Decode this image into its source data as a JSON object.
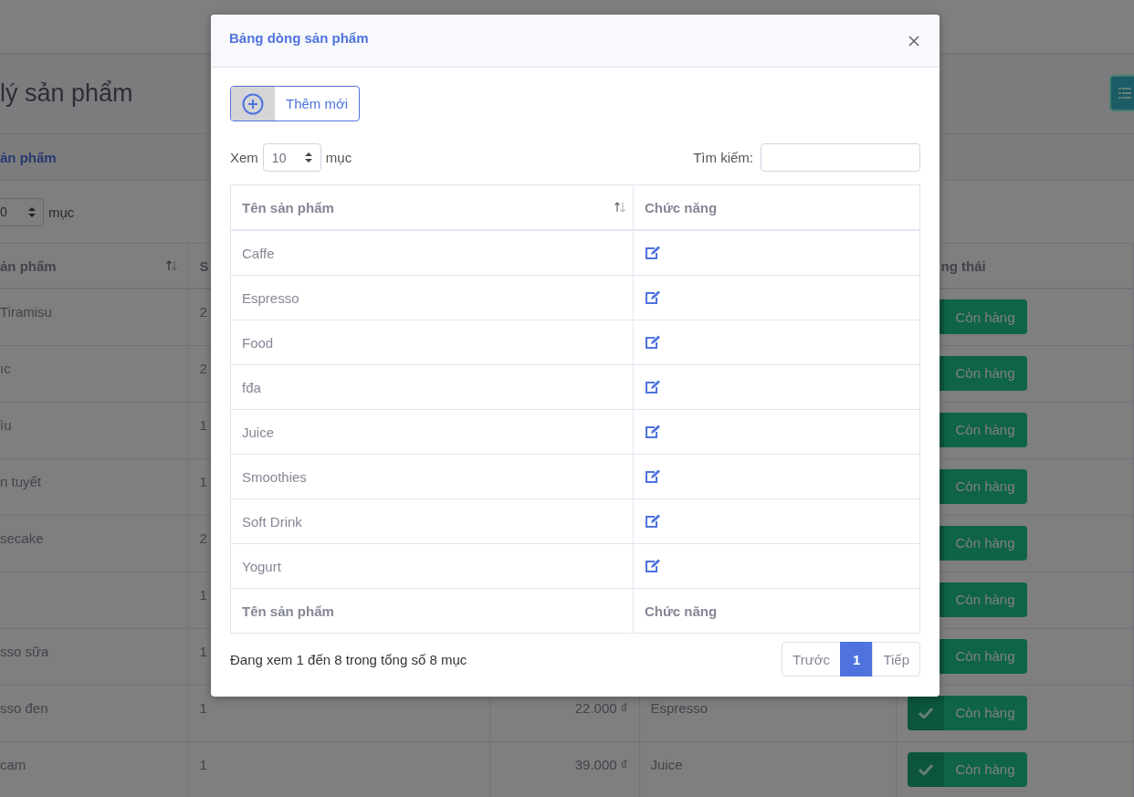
{
  "page": {
    "title": "lý sản phẩm"
  },
  "card": {
    "header": "ản phẩm",
    "length_value": "0",
    "length_label": "mục"
  },
  "table": {
    "columns": [
      {
        "label": "ản phẩm",
        "sortable": true
      },
      {
        "label": "S"
      },
      {},
      {},
      {
        "label": "ng thái"
      }
    ],
    "rows": [
      {
        "name": " Tiramisu",
        "column_2": "2",
        "status": "Còn hàng"
      },
      {
        "name": "ıc",
        "column_2": "2",
        "status": "Còn hàng"
      },
      {
        "name": "ìu",
        "column_2": "1",
        "status": "Còn hàng"
      },
      {
        "name": "n tuyết",
        "column_2": "1",
        "status": "Còn hàng"
      },
      {
        "name": "secake",
        "column_2": "2",
        "status": "Còn hàng"
      },
      {
        "column_2": "1",
        "status": "Còn hàng"
      },
      {
        "name": "sso sữa",
        "column_2": "1",
        "status": "Còn hàng"
      },
      {
        "name": "sso đen",
        "column_2": "1",
        "price": "22.000 ₫",
        "category": "Espresso",
        "status": "Còn hàng"
      },
      {
        "name": " cam",
        "column_2": "1",
        "price": "39.000 ₫",
        "category": "Juice",
        "status": "Còn hàng"
      }
    ]
  },
  "modal": {
    "title": "Bảng dòng sản phẩm",
    "add_button": "Thêm mới",
    "length_prefix": "Xem",
    "length_value": "10",
    "length_suffix": "mục",
    "search_label": "Tìm kiếm:",
    "columns": [
      {
        "label": "Tên sản phẩm",
        "sortable": true
      },
      {
        "label": "Chức năng"
      }
    ],
    "rows": [
      {
        "name": "Caffe"
      },
      {
        "name": "Espresso"
      },
      {
        "name": "Food"
      },
      {
        "name": "fđa"
      },
      {
        "name": "Juice"
      },
      {
        "name": "Smoothies"
      },
      {
        "name": "Soft Drink"
      },
      {
        "name": "Yogurt"
      }
    ],
    "footer_columns": [
      "Tên sản phẩm",
      "Chức năng"
    ],
    "info": "Đang xem 1 đến 8 trong tổng số 8 mục",
    "pagination": [
      {
        "label": "Trước",
        "kind": "prev",
        "selected": false
      },
      {
        "label": "1",
        "kind": "page",
        "selected": true
      },
      {
        "label": "Tiếp",
        "kind": "next",
        "selected": false
      }
    ]
  }
}
